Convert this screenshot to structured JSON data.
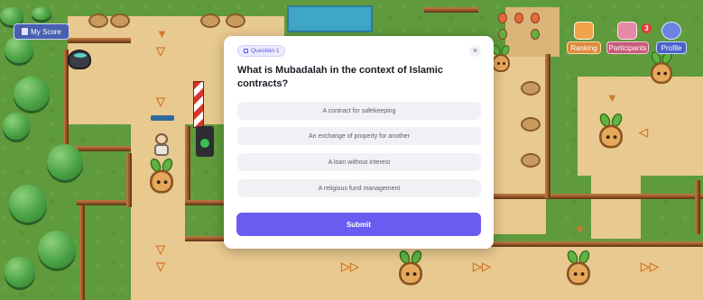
{
  "hud": {
    "my_score_label": "My Score",
    "ranking_label": "Ranking",
    "participants_label": "Participants",
    "participants_badge": "3",
    "profile_label": "Profile"
  },
  "quiz": {
    "question_tag": "Question 1",
    "question": "What is Mubadalah in the context of Islamic contracts?",
    "options": [
      "A contract for safekeeping",
      "An exchange of property for another",
      "A loan without interest",
      "A religious fund management"
    ],
    "submit_label": "Submit",
    "close_symbol": "×"
  },
  "colors": {
    "accent": "#6a5cf0",
    "grass": "#5f9a3c",
    "path": "#e8c98f",
    "fence": "#9a5a2c"
  }
}
